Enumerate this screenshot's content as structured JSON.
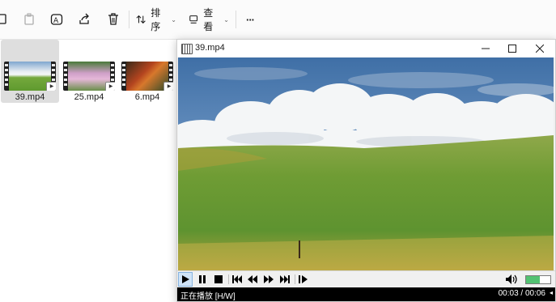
{
  "explorer": {
    "toolbar": {
      "sort_label": "排序",
      "view_label": "查看",
      "more_label": "···"
    },
    "files": [
      {
        "name": "39.mp4",
        "selected": true
      },
      {
        "name": "25.mp4",
        "selected": false
      },
      {
        "name": "6.mp4",
        "selected": false
      }
    ]
  },
  "player": {
    "title": "39.mp4",
    "status_text": "正在播放 [H/W]",
    "time_text": "00:03 / 00:06",
    "status_arrow": "◂",
    "volume_level": 0.55
  },
  "colors": {
    "accent": "#cfe3f7",
    "volume": "#52c272",
    "statusbar": "#000000"
  }
}
